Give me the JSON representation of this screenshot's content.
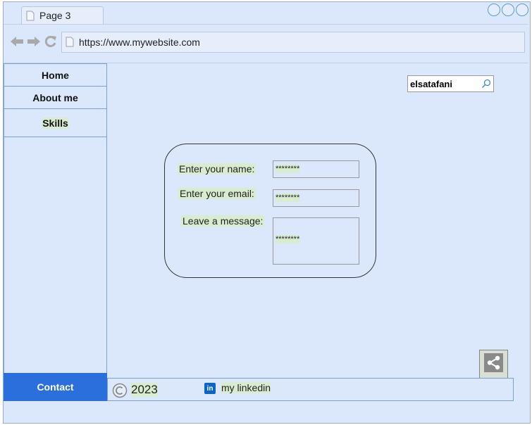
{
  "browser": {
    "tab_title": "Page 3",
    "url": "https://www.mywebsite.com"
  },
  "sidebar": {
    "items": [
      {
        "label": "Home"
      },
      {
        "label": "About me"
      },
      {
        "label": "Skills"
      }
    ],
    "contact_label": "Contact"
  },
  "search": {
    "value": "elsatafani"
  },
  "form": {
    "name_label": "Enter your name:",
    "name_value": "********",
    "email_label": "Enter your email:",
    "email_value": "********",
    "message_label": "Leave a message:",
    "message_value": "********"
  },
  "footer": {
    "year": "2023",
    "linkedin_icon_text": "in",
    "linkedin_label": "my linkedin"
  },
  "colors": {
    "background": "#dbe8fb",
    "accent": "#2a6fdb",
    "label_highlight": "#d8ecd0",
    "linkedin": "#0a66c2"
  }
}
